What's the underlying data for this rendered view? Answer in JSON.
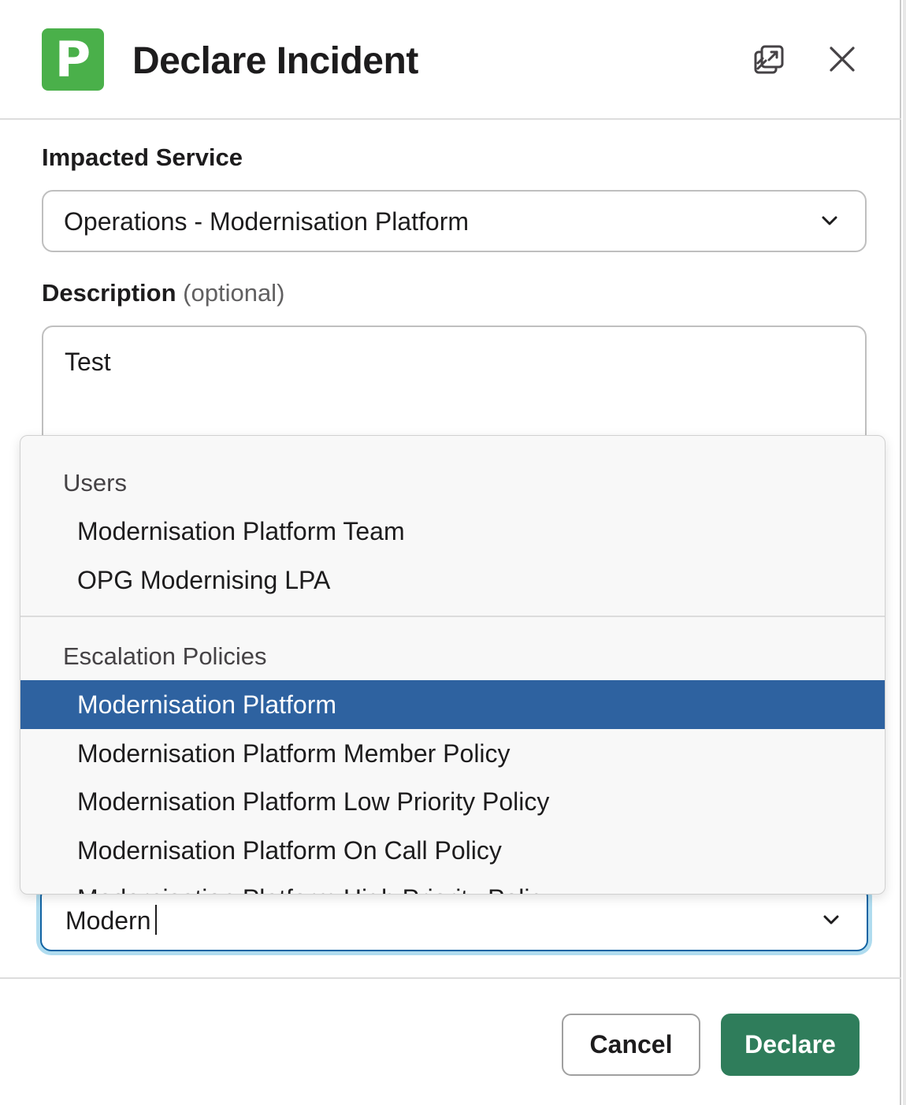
{
  "header": {
    "logo_letter": "P",
    "title": "Declare Incident",
    "popout_icon": "popout-window-icon",
    "close_icon": "close-icon"
  },
  "impacted_service": {
    "label": "Impacted Service",
    "value": "Operations - Modernisation Platform"
  },
  "description": {
    "label": "Description",
    "optional": "(optional)",
    "value": "Test"
  },
  "dropdown": {
    "groups": [
      {
        "header": "Users",
        "options": [
          {
            "label": "Modernisation Platform Team"
          },
          {
            "label": "OPG Modernising  LPA"
          }
        ]
      },
      {
        "header": "Escalation Policies",
        "options": [
          {
            "label": "Modernisation Platform",
            "selected": true
          },
          {
            "label": "Modernisation Platform Member Policy"
          },
          {
            "label": "Modernisation Platform Low Priority Policy"
          },
          {
            "label": "Modernisation Platform On Call Policy"
          },
          {
            "label": "Modernisation Platform High Priority Policy"
          }
        ]
      }
    ]
  },
  "assignee_search": {
    "value": "Modern"
  },
  "footer": {
    "cancel_label": "Cancel",
    "declare_label": "Declare"
  },
  "colors": {
    "logo_green": "#4ab04a",
    "selected_option": "#2e62a0",
    "declare_button": "#2f7d5b",
    "focus_ring": "#1264a3"
  }
}
